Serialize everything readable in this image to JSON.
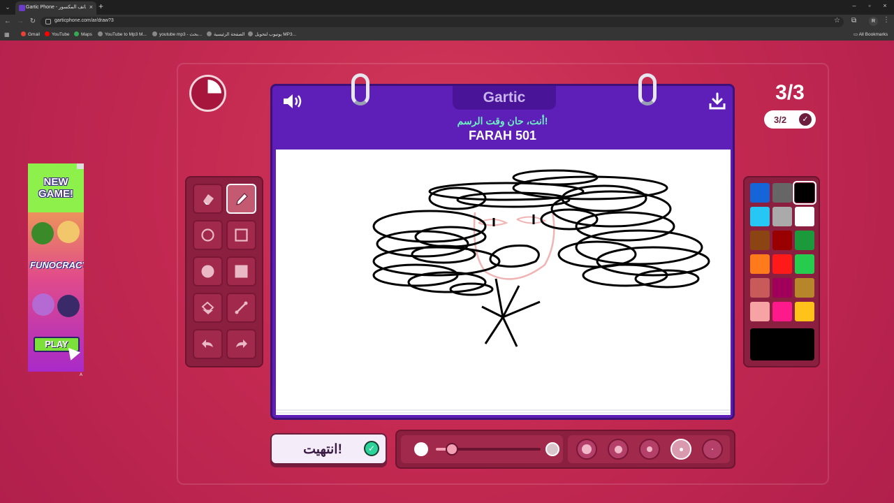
{
  "browser": {
    "tab_title": "Gartic Phone - الهاتف المكسور",
    "url": "garticphone.com/ar/draw?3",
    "bookmarks": [
      "Gmail",
      "YouTube",
      "Maps",
      "YouTube to Mp3 M...",
      "youtube mp3 - بحث...",
      "الصفحة الرئيسية",
      "يوتيوب لتحويل MP3..."
    ],
    "all_bookmarks": "All Bookmarks",
    "profile_initial": "R"
  },
  "game": {
    "logo": "Gartic",
    "prompt": "أنت، حان وقت الرسم!",
    "player_name": "FARAH 501",
    "round": "3/3",
    "players_done": "3/2",
    "done_button": "انتهيت!",
    "timer_remaining_fraction": 0.25
  },
  "ad": {
    "headline": "NEW GAME!",
    "brand": "FUNOCRACY",
    "cta": "PLAY",
    "marker": "A"
  },
  "tools": [
    {
      "id": "eraser",
      "icon": "eraser-icon",
      "selected": false
    },
    {
      "id": "pencil",
      "icon": "pencil-icon",
      "selected": true
    },
    {
      "id": "circle-outline",
      "icon": "circle-outline-icon",
      "selected": false
    },
    {
      "id": "square-outline",
      "icon": "square-outline-icon",
      "selected": false
    },
    {
      "id": "circle-filled",
      "icon": "circle-filled-icon",
      "selected": false
    },
    {
      "id": "square-filled",
      "icon": "square-filled-icon",
      "selected": false
    },
    {
      "id": "fill",
      "icon": "paint-bucket-icon",
      "selected": false
    },
    {
      "id": "line",
      "icon": "line-icon",
      "selected": false
    },
    {
      "id": "undo",
      "icon": "undo-icon",
      "selected": false
    },
    {
      "id": "redo",
      "icon": "redo-icon",
      "selected": false
    }
  ],
  "colors": [
    "#1565d8",
    "#666666",
    "#000000",
    "#26c6f5",
    "#aaaaaa",
    "#ffffff",
    "#8b4513",
    "#990000",
    "#1a9a3a",
    "#ff7a1a",
    "#ff1a1a",
    "#26cc4d",
    "#c85a5a",
    "#a0005a",
    "#b8862a",
    "#f5a3a3",
    "#ff1a8c",
    "#ffc21a"
  ],
  "selected_color": "#000000",
  "brush": {
    "opacity_fraction": 0.15,
    "sizes": [
      "size-xl",
      "size-lg",
      "size-md",
      "size-sm",
      "size-xs"
    ],
    "selected_size_index": 3
  }
}
